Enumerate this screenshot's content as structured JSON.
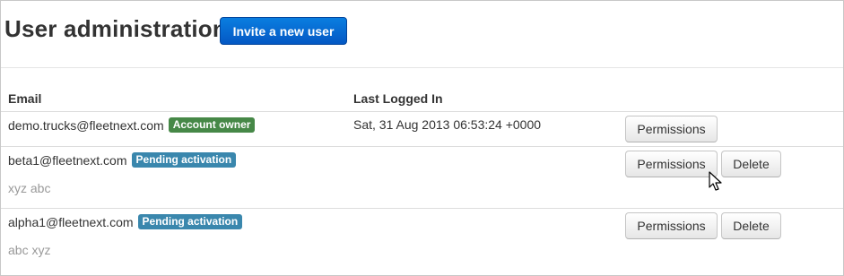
{
  "header": {
    "title": "User administration",
    "invite_label": "Invite a new user"
  },
  "table": {
    "columns": [
      "Email",
      "Last Logged In"
    ],
    "rows": [
      {
        "email": "demo.trucks@fleetnext.com",
        "badge": "Account owner",
        "last_logged_in": "Sat, 31 Aug 2013 06:53:24 +0000",
        "note": "",
        "actions": [
          "Permissions"
        ]
      },
      {
        "email": "beta1@fleetnext.com",
        "badge": "Pending activation",
        "last_logged_in": "",
        "note": "xyz abc",
        "actions": [
          "Permissions",
          "Delete"
        ]
      },
      {
        "email": "alpha1@fleetnext.com",
        "badge": "Pending activation",
        "last_logged_in": "",
        "note": "abc xyz",
        "actions": [
          "Permissions",
          "Delete"
        ]
      }
    ]
  },
  "colors": {
    "primary": "#0664d0",
    "owner_badge": "#468847",
    "pending_badge": "#3a87ad"
  },
  "icons": [
    "mouse-pointer-icon"
  ]
}
